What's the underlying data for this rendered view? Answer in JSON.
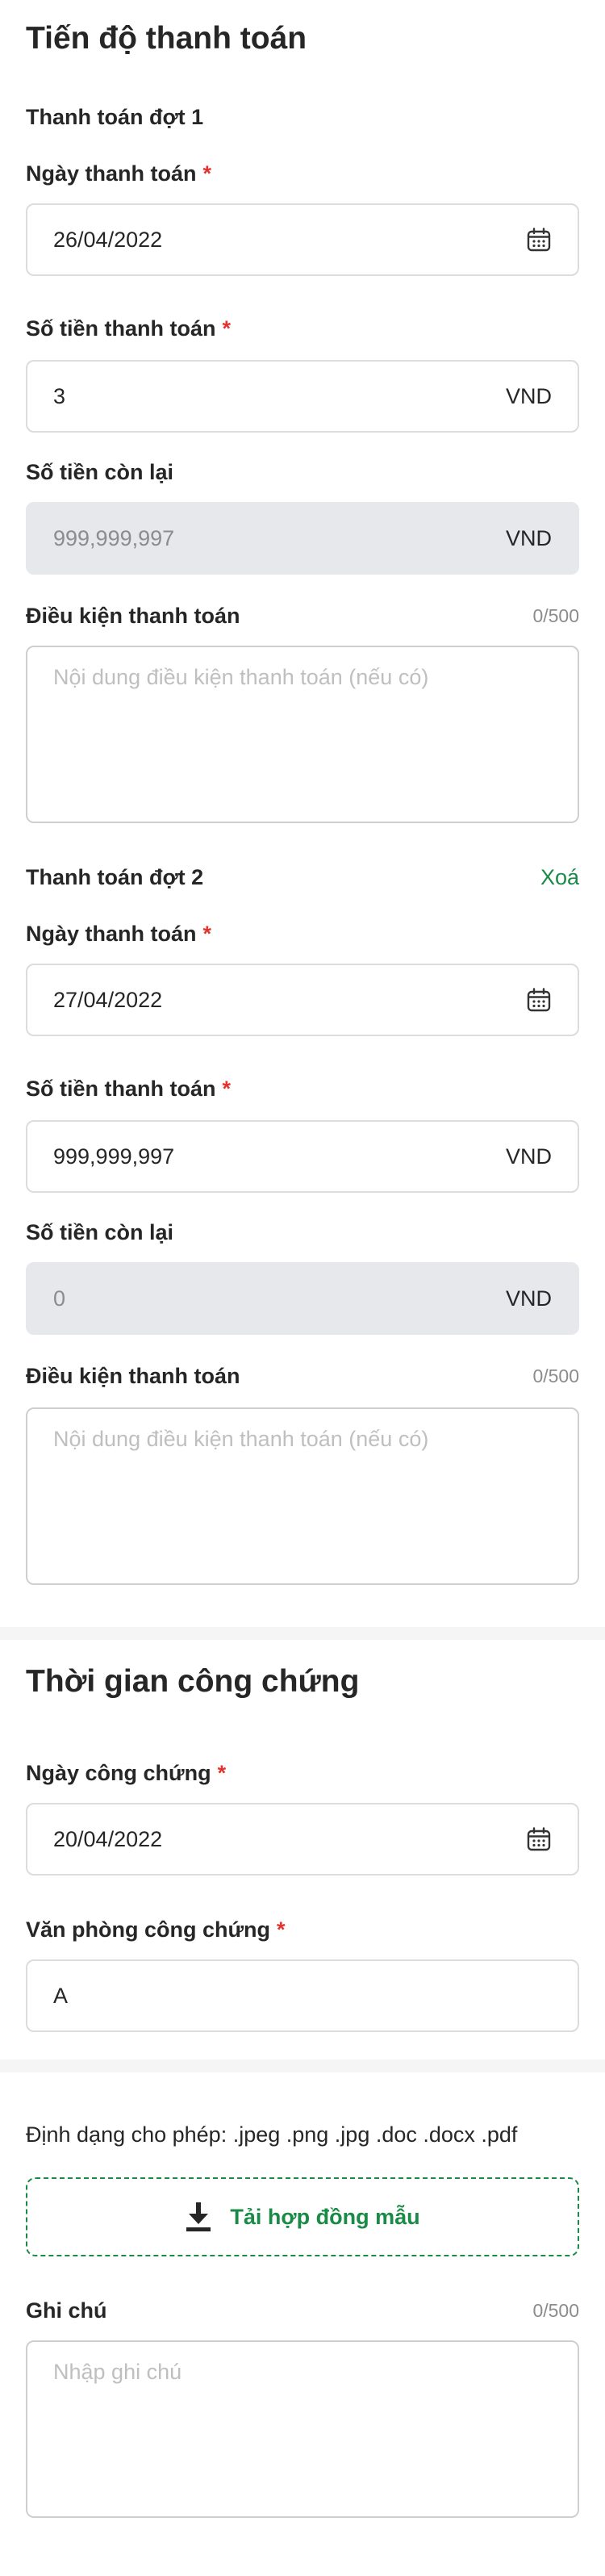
{
  "payment_schedule": {
    "title": "Tiến độ thanh toán",
    "installments": [
      {
        "heading": "Thanh toán đợt 1",
        "date_label": "Ngày thanh toán",
        "date_value": "26/04/2022",
        "amount_label": "Số tiền thanh toán",
        "amount_value": "3",
        "amount_unit": "VND",
        "remaining_label": "Số tiền còn lại",
        "remaining_value": "999,999,997",
        "remaining_unit": "VND",
        "terms_label": "Điều kiện thanh toán",
        "terms_counter": "0/500",
        "terms_placeholder": "Nội dung điều kiện thanh toán (nếu có)"
      },
      {
        "heading": "Thanh toán đợt 2",
        "delete_label": "Xoá",
        "date_label": "Ngày thanh toán",
        "date_value": "27/04/2022",
        "amount_label": "Số tiền thanh toán",
        "amount_value": "999,999,997",
        "amount_unit": "VND",
        "remaining_label": "Số tiền còn lại",
        "remaining_value": "0",
        "remaining_unit": "VND",
        "terms_label": "Điều kiện thanh toán",
        "terms_counter": "0/500",
        "terms_placeholder": "Nội dung điều kiện thanh toán (nếu có)"
      }
    ]
  },
  "notarization": {
    "title": "Thời gian công chứng",
    "date_label": "Ngày công chứng",
    "date_value": "20/04/2022",
    "office_label": "Văn phòng công chứng",
    "office_value": "A"
  },
  "attachments": {
    "allowed_formats": "Định dạng cho phép: .jpeg .png .jpg .doc .docx .pdf",
    "download_template_label": "Tải hợp đồng mẫu",
    "note_label": "Ghi chú",
    "note_counter": "0/500",
    "note_placeholder": "Nhập ghi chú"
  },
  "required_mark": "*",
  "colors": {
    "accent": "#1a8a47",
    "required": "#e5322d",
    "disabled_bg": "#e6e8eb",
    "separator": "#f5f5f5"
  },
  "icons": {
    "calendar": "calendar-icon",
    "download": "download-icon"
  }
}
